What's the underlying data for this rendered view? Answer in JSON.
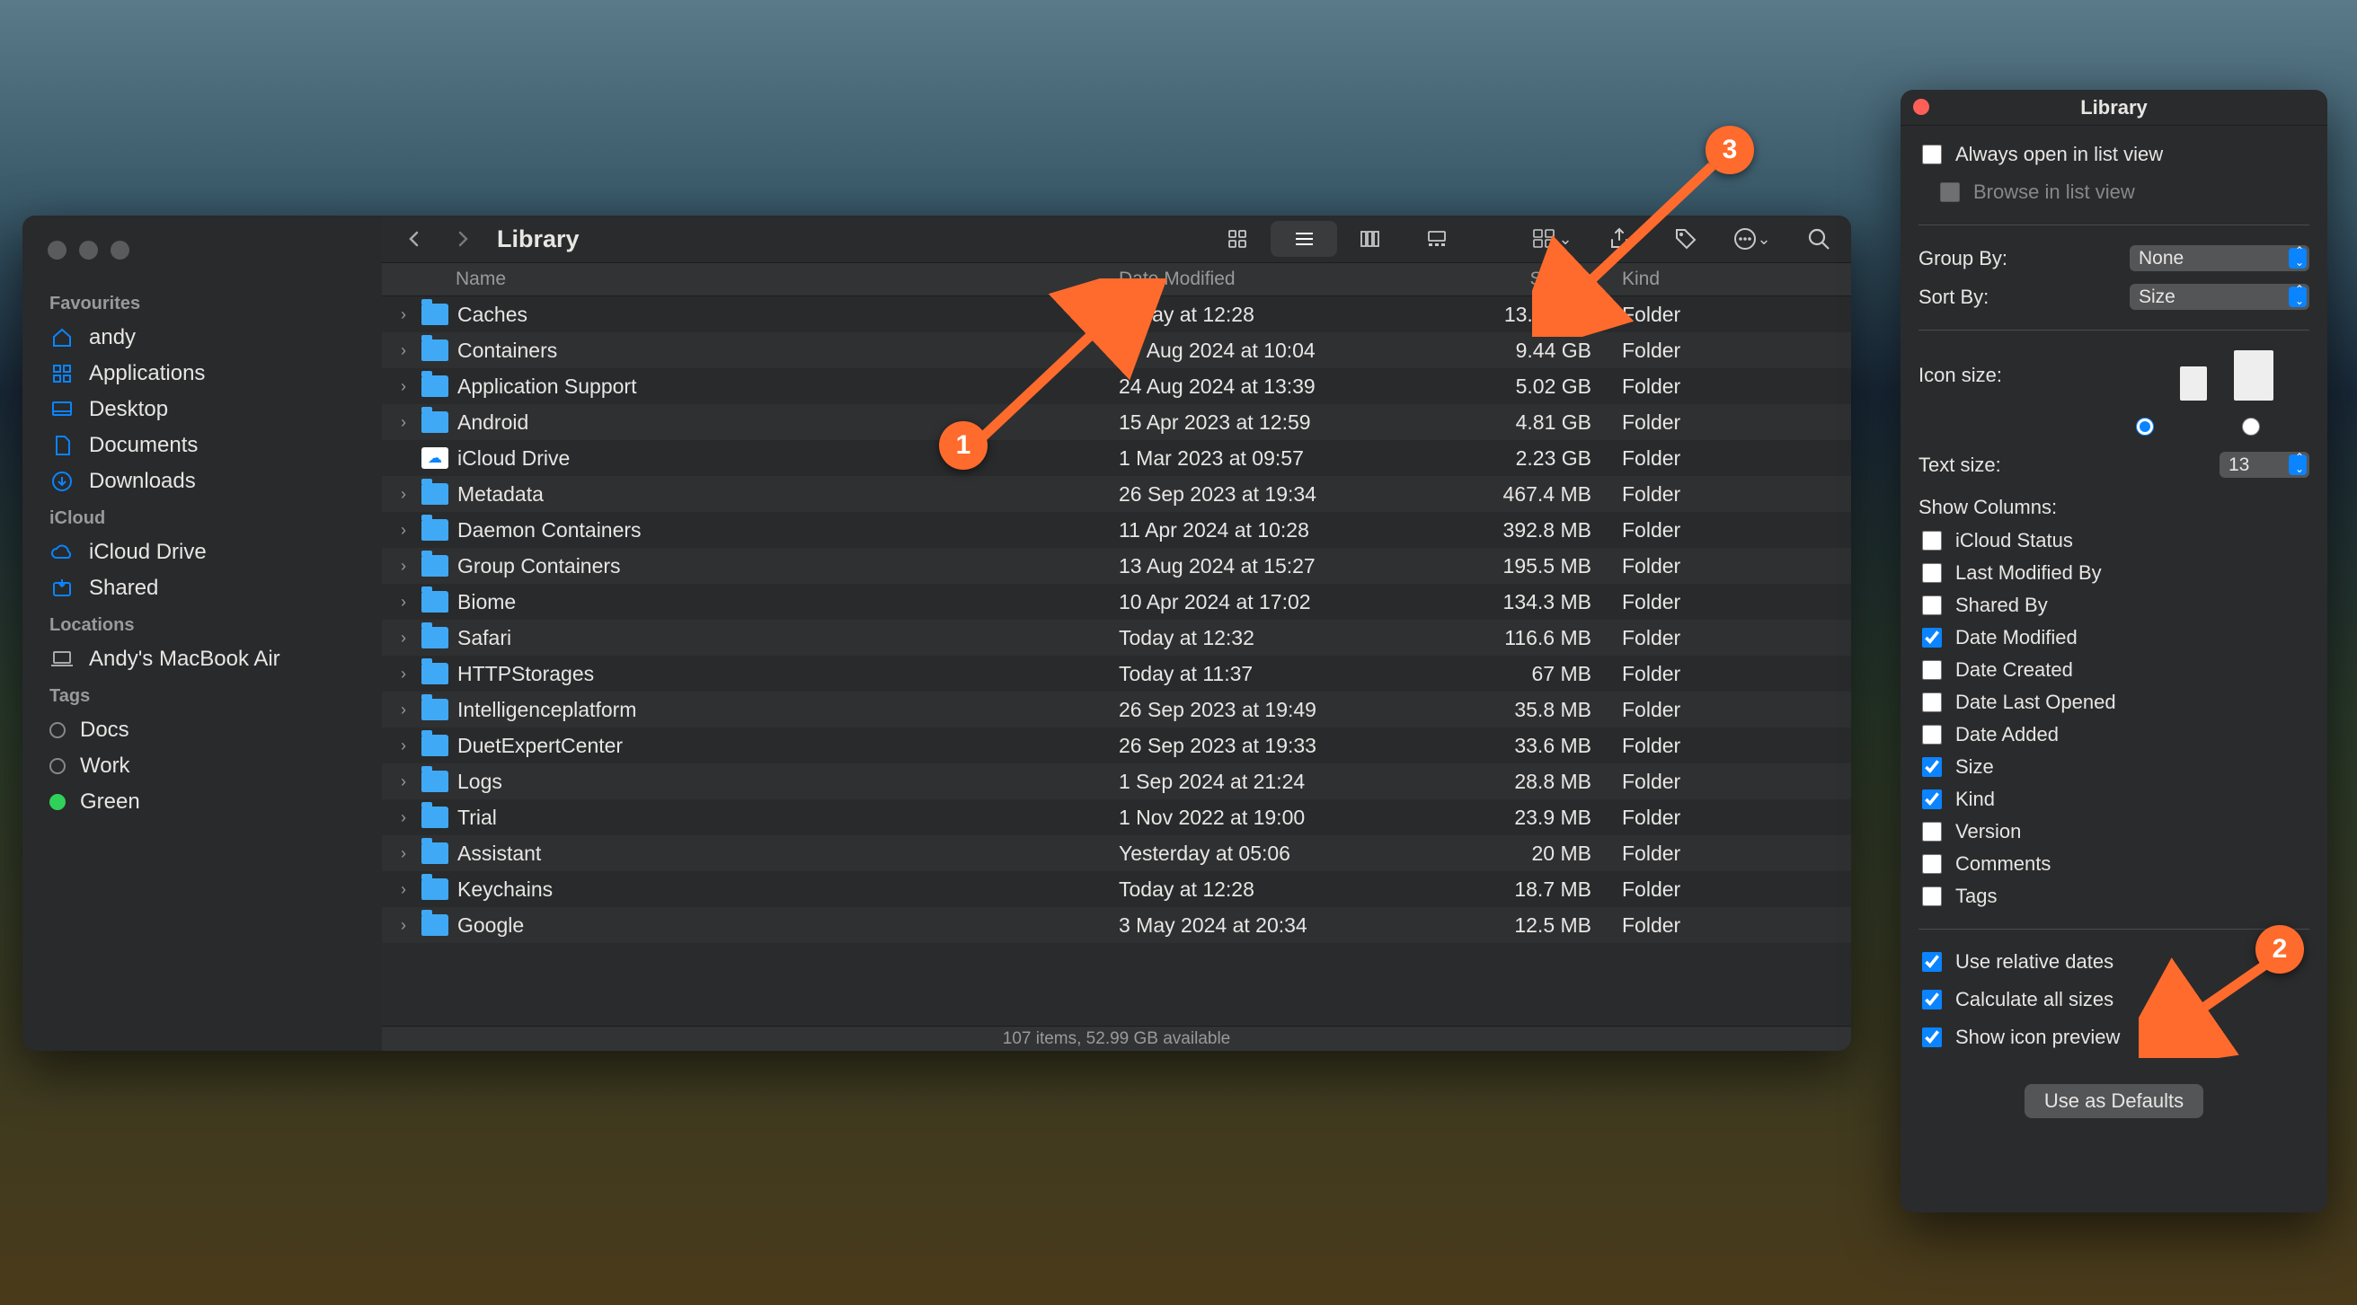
{
  "finder": {
    "title": "Library",
    "sidebar": {
      "groups": [
        {
          "label": "Favourites",
          "items": [
            {
              "icon": "house",
              "label": "andy"
            },
            {
              "icon": "grid",
              "label": "Applications"
            },
            {
              "icon": "desktop",
              "label": "Desktop"
            },
            {
              "icon": "doc",
              "label": "Documents"
            },
            {
              "icon": "down",
              "label": "Downloads"
            }
          ]
        },
        {
          "label": "iCloud",
          "items": [
            {
              "icon": "cloud",
              "label": "iCloud Drive"
            },
            {
              "icon": "share",
              "label": "Shared"
            }
          ]
        },
        {
          "label": "Locations",
          "items": [
            {
              "icon": "laptop",
              "label": "Andy's MacBook Air"
            }
          ]
        },
        {
          "label": "Tags",
          "items": [
            {
              "icon": "tag",
              "label": "Docs"
            },
            {
              "icon": "tag",
              "label": "Work"
            },
            {
              "icon": "tag-green",
              "label": "Green"
            }
          ]
        }
      ]
    },
    "columns": {
      "name": "Name",
      "date": "Date Modified",
      "size": "Size",
      "kind": "Kind"
    },
    "sort_indicator": "⌄",
    "rows": [
      {
        "name": "Caches",
        "date": "Today at 12:28",
        "size": "13.69 GB",
        "kind": "Folder",
        "icon": "folder"
      },
      {
        "name": "Containers",
        "date": "27 Aug 2024 at 10:04",
        "size": "9.44 GB",
        "kind": "Folder",
        "icon": "folder"
      },
      {
        "name": "Application Support",
        "date": "24 Aug 2024 at 13:39",
        "size": "5.02 GB",
        "kind": "Folder",
        "icon": "folder"
      },
      {
        "name": "Android",
        "date": "15 Apr 2023 at 12:59",
        "size": "4.81 GB",
        "kind": "Folder",
        "icon": "folder"
      },
      {
        "name": "iCloud Drive",
        "date": "1 Mar 2023 at 09:57",
        "size": "2.23 GB",
        "kind": "Folder",
        "icon": "cloud"
      },
      {
        "name": "Metadata",
        "date": "26 Sep 2023 at 19:34",
        "size": "467.4 MB",
        "kind": "Folder",
        "icon": "folder"
      },
      {
        "name": "Daemon Containers",
        "date": "11 Apr 2024 at 10:28",
        "size": "392.8 MB",
        "kind": "Folder",
        "icon": "folder"
      },
      {
        "name": "Group Containers",
        "date": "13 Aug 2024 at 15:27",
        "size": "195.5 MB",
        "kind": "Folder",
        "icon": "folder"
      },
      {
        "name": "Biome",
        "date": "10 Apr 2024 at 17:02",
        "size": "134.3 MB",
        "kind": "Folder",
        "icon": "folder"
      },
      {
        "name": "Safari",
        "date": "Today at 12:32",
        "size": "116.6 MB",
        "kind": "Folder",
        "icon": "folder"
      },
      {
        "name": "HTTPStorages",
        "date": "Today at 11:37",
        "size": "67 MB",
        "kind": "Folder",
        "icon": "folder"
      },
      {
        "name": "Intelligenceplatform",
        "date": "26 Sep 2023 at 19:49",
        "size": "35.8 MB",
        "kind": "Folder",
        "icon": "folder"
      },
      {
        "name": "DuetExpertCenter",
        "date": "26 Sep 2023 at 19:33",
        "size": "33.6 MB",
        "kind": "Folder",
        "icon": "folder"
      },
      {
        "name": "Logs",
        "date": "1 Sep 2024 at 21:24",
        "size": "28.8 MB",
        "kind": "Folder",
        "icon": "folder"
      },
      {
        "name": "Trial",
        "date": "1 Nov 2022 at 19:00",
        "size": "23.9 MB",
        "kind": "Folder",
        "icon": "folder"
      },
      {
        "name": "Assistant",
        "date": "Yesterday at 05:06",
        "size": "20 MB",
        "kind": "Folder",
        "icon": "folder"
      },
      {
        "name": "Keychains",
        "date": "Today at 12:28",
        "size": "18.7 MB",
        "kind": "Folder",
        "icon": "folder"
      },
      {
        "name": "Google",
        "date": "3 May 2024 at 20:34",
        "size": "12.5 MB",
        "kind": "Folder",
        "icon": "folder"
      }
    ],
    "status": "107 items, 52.99 GB available"
  },
  "opts": {
    "title": "Library",
    "always_open": "Always open in list view",
    "browse": "Browse in list view",
    "group_by_label": "Group By:",
    "group_by": "None",
    "sort_by_label": "Sort By:",
    "sort_by": "Size",
    "icon_size": "Icon size:",
    "text_size_label": "Text size:",
    "text_size": "13",
    "show_columns": "Show Columns:",
    "cols": [
      {
        "label": "iCloud Status",
        "checked": false
      },
      {
        "label": "Last Modified By",
        "checked": false
      },
      {
        "label": "Shared By",
        "checked": false
      },
      {
        "label": "Date Modified",
        "checked": true
      },
      {
        "label": "Date Created",
        "checked": false
      },
      {
        "label": "Date Last Opened",
        "checked": false
      },
      {
        "label": "Date Added",
        "checked": false
      },
      {
        "label": "Size",
        "checked": true
      },
      {
        "label": "Kind",
        "checked": true
      },
      {
        "label": "Version",
        "checked": false
      },
      {
        "label": "Comments",
        "checked": false
      },
      {
        "label": "Tags",
        "checked": false
      }
    ],
    "use_relative": "Use relative dates",
    "calc_all": "Calculate all sizes",
    "icon_preview": "Show icon preview",
    "defaults": "Use as Defaults"
  },
  "annotations": {
    "b1": "1",
    "b2": "2",
    "b3": "3"
  }
}
